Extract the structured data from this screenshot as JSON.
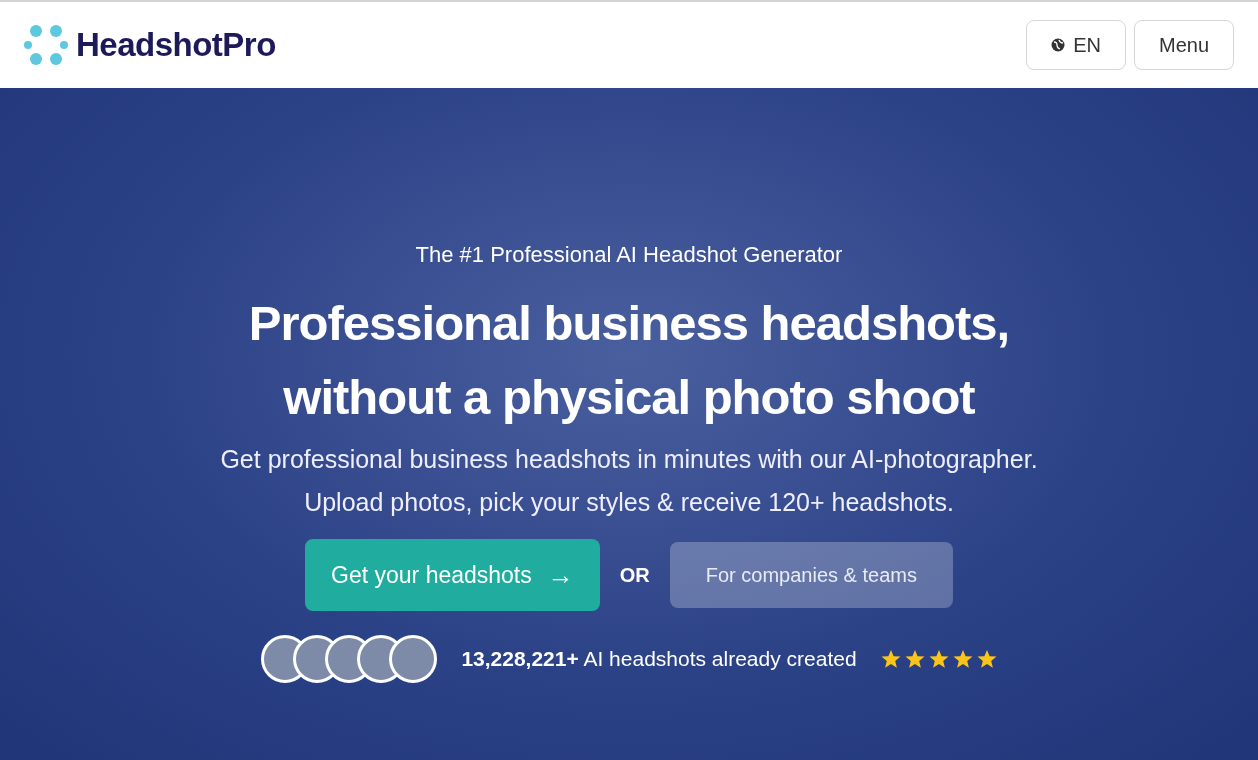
{
  "header": {
    "brand": "HeadshotPro",
    "language_button": "EN",
    "menu_button": "Menu"
  },
  "hero": {
    "eyebrow": "The #1 Professional AI Headshot Generator",
    "headline_lines": [
      "Professional business headshots,",
      "without a physical photo shoot"
    ],
    "subtitle_lines": [
      "Get professional business headshots in minutes with our AI-photographer.",
      "Upload photos, pick your styles & receive 120+ headshots."
    ],
    "primary_button": "Get your headshots",
    "primary_arrow": "→",
    "separator": "OR",
    "secondary_button": "For companies & teams",
    "avatars": [
      {
        "kind": "photo"
      },
      {
        "kind": "photo"
      },
      {
        "kind": "photo"
      },
      {
        "kind": "photo"
      },
      {
        "kind": "photo"
      }
    ],
    "stat": "**13,228,221+** AI headshots already created",
    "rating": {
      "stars": 5
    }
  }
}
